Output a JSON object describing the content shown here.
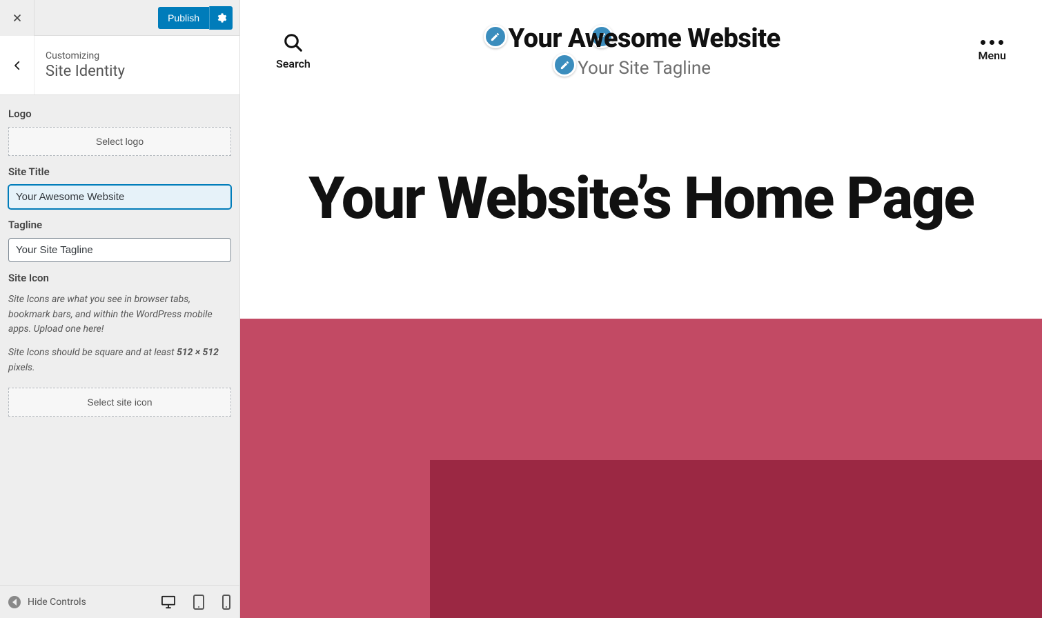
{
  "topbar": {
    "publish_label": "Publish"
  },
  "panel": {
    "crumb": "Customizing",
    "title": "Site Identity",
    "logo_label": "Logo",
    "select_logo_label": "Select logo",
    "site_title_label": "Site Title",
    "site_title_value": "Your Awesome Website",
    "tagline_label": "Tagline",
    "tagline_value": "Your Site Tagline",
    "site_icon_label": "Site Icon",
    "site_icon_help1": "Site Icons are what you see in browser tabs, bookmark bars, and within the WordPress mobile apps. Upload one here!",
    "site_icon_help2a": "Site Icons should be square and at least ",
    "site_icon_help2b": "512 × 512",
    "site_icon_help2c": " pixels.",
    "select_site_icon_label": "Select site icon"
  },
  "footer": {
    "hide_controls_label": "Hide Controls"
  },
  "preview": {
    "search_label": "Search",
    "menu_label": "Menu",
    "site_title": "Your Awesome Website",
    "site_tagline": "Your Site Tagline",
    "hero_heading": "Your Website’s Home Page"
  }
}
